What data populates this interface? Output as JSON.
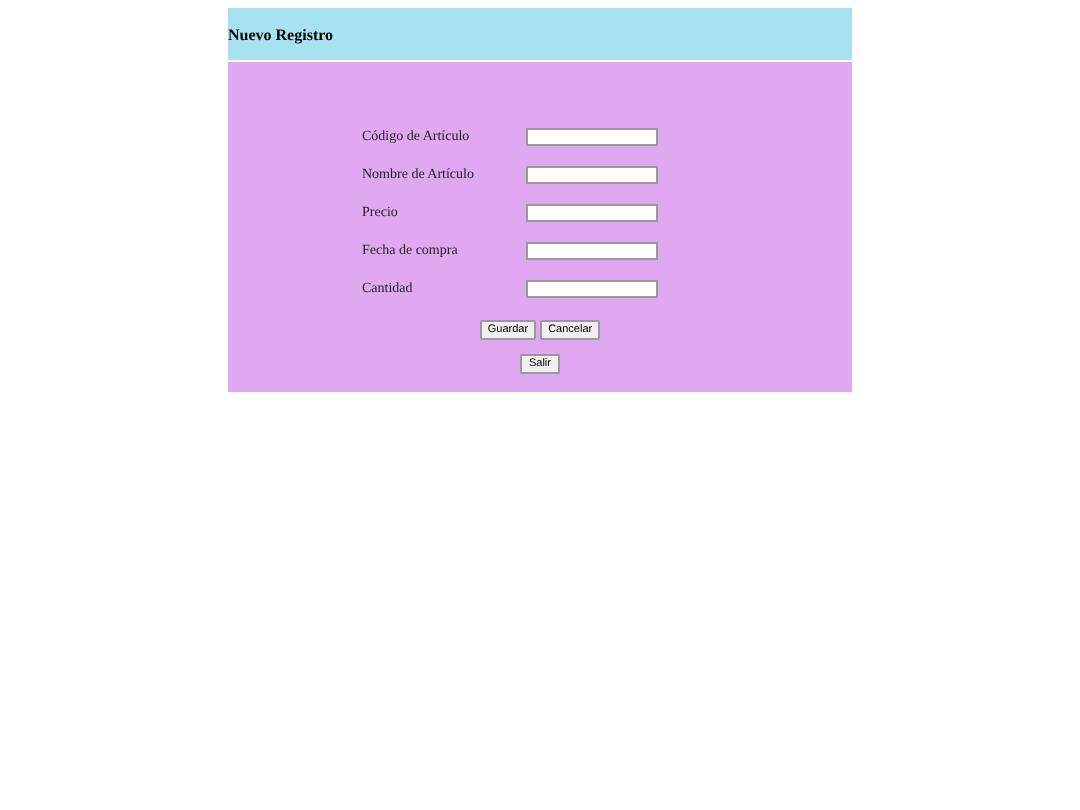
{
  "header": {
    "title": "Nuevo Registro"
  },
  "fields": [
    {
      "label": "Código de Artículo"
    },
    {
      "label": "Nombre de Artículo"
    },
    {
      "label": "Precio"
    },
    {
      "label": "Fecha de compra"
    },
    {
      "label": "Cantidad"
    }
  ],
  "buttons": [
    [
      "Guardar",
      "Cancelar"
    ],
    [
      "Salir"
    ]
  ]
}
